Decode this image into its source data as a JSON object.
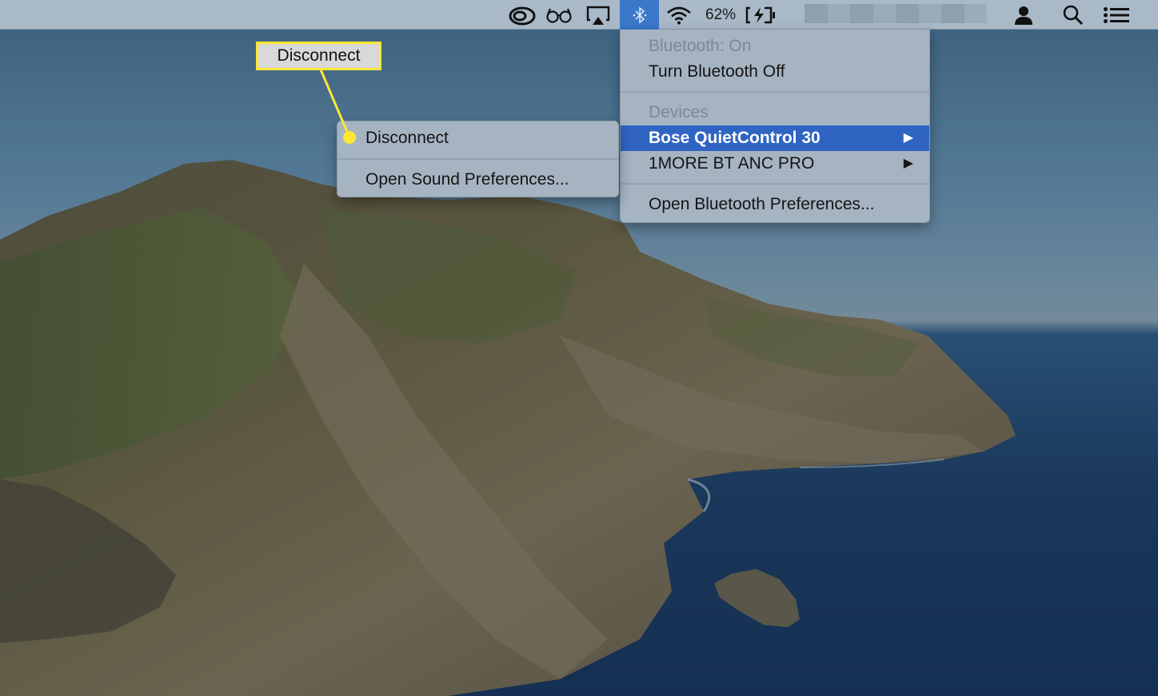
{
  "menubar": {
    "icons": [
      "creative-cloud-icon",
      "glasses-icon",
      "airplay-icon",
      "bluetooth-icon",
      "wifi-icon",
      "battery-charging-icon",
      "user-icon",
      "search-icon",
      "notification-center-icon"
    ],
    "battery_percent": "62%",
    "bluetooth_highlight_color": "#3a78c9"
  },
  "bluetooth_menu": {
    "status": "Bluetooth: On",
    "toggle": "Turn Bluetooth Off",
    "devices_header": "Devices",
    "devices": [
      {
        "name": "Bose QuietControl 30",
        "selected": true,
        "has_submenu": true
      },
      {
        "name": "1MORE BT ANC PRO",
        "selected": false,
        "has_submenu": true
      }
    ],
    "preferences": "Open Bluetooth Preferences...",
    "submenu_arrow": "▶",
    "selection_color": "#2f64c2"
  },
  "device_submenu": {
    "items": [
      "Disconnect",
      "Open Sound Preferences..."
    ]
  },
  "callout": {
    "label": "Disconnect",
    "color": "#ffe733"
  }
}
